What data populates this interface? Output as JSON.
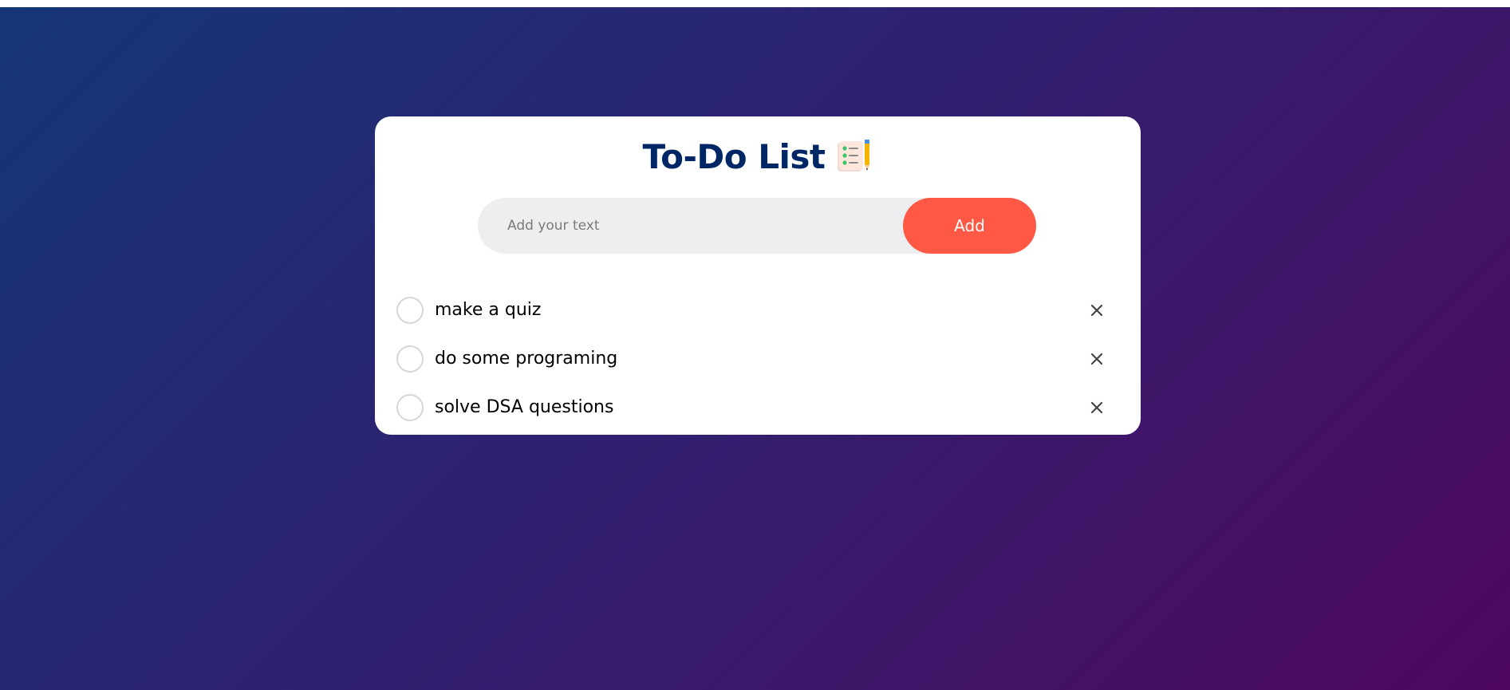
{
  "app": {
    "title": "To-Do List",
    "title_icon": "notepad-pencil-icon"
  },
  "input": {
    "placeholder": "Add your text",
    "value": "",
    "add_label": "Add"
  },
  "tasks": [
    {
      "text": "make a quiz",
      "done": false
    },
    {
      "text": "do some programing",
      "done": false
    },
    {
      "text": "solve DSA questions",
      "done": false
    }
  ],
  "colors": {
    "title": "#002765",
    "accent": "#ff5945",
    "input_bg": "#edeef0",
    "gradient_start": "#153677",
    "gradient_end": "#4e085f"
  }
}
